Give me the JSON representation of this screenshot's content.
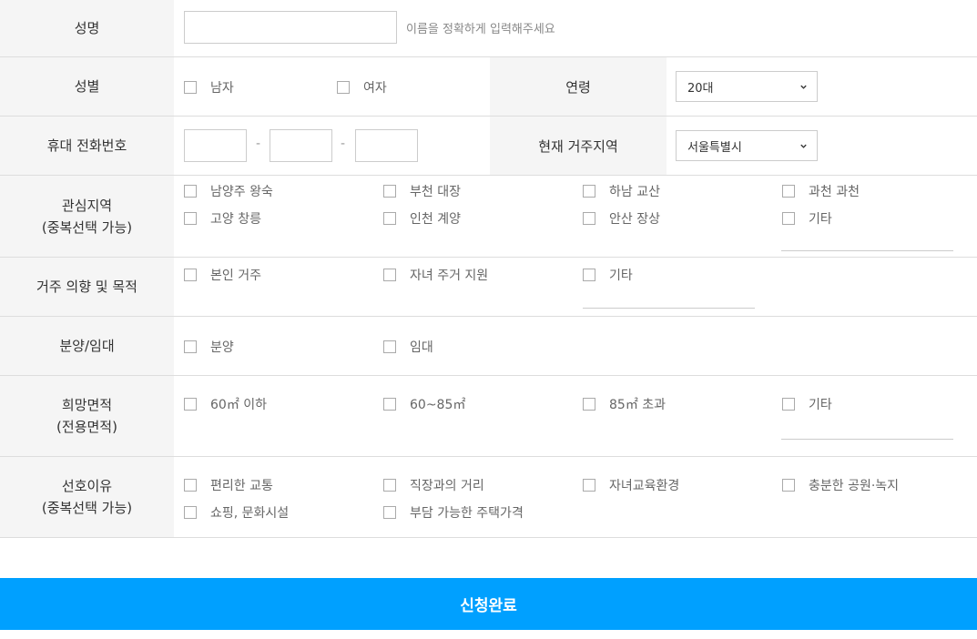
{
  "name": {
    "label": "성명",
    "value": "",
    "hint": "이름을 정확하게 입력해주세요"
  },
  "gender": {
    "label": "성별",
    "options": [
      "남자",
      "여자"
    ]
  },
  "age": {
    "label": "연령",
    "selected": "20대"
  },
  "phone": {
    "label": "휴대 전화번호",
    "sep": "-"
  },
  "residence": {
    "label": "현재 거주지역",
    "selected": "서울특별시"
  },
  "interest": {
    "label_lines": [
      "관심지역",
      "(중복선택 가능)"
    ],
    "options": [
      "남양주 왕숙",
      "부천 대장",
      "하남 교산",
      "과천 과천",
      "고양 창릉",
      "인천 계양",
      "안산 장상",
      "기타"
    ]
  },
  "intent": {
    "label": "거주 의향 및 목적",
    "options": [
      "본인 거주",
      "자녀 주거 지원",
      "기타"
    ]
  },
  "saletype": {
    "label": "분양/임대",
    "options": [
      "분양",
      "임대"
    ]
  },
  "area": {
    "label_lines": [
      "희망면적",
      "(전용면적)"
    ],
    "options": [
      "60㎡ 이하",
      "60~85㎡",
      "85㎡ 초과",
      "기타"
    ]
  },
  "reason": {
    "label_lines": [
      "선호이유",
      "(중복선택 가능)"
    ],
    "options": [
      "편리한 교통",
      "직장과의 거리",
      "자녀교육환경",
      "충분한 공원·녹지",
      "쇼핑, 문화시설",
      "부담 가능한 주택가격"
    ]
  },
  "submit_label": "신청완료"
}
